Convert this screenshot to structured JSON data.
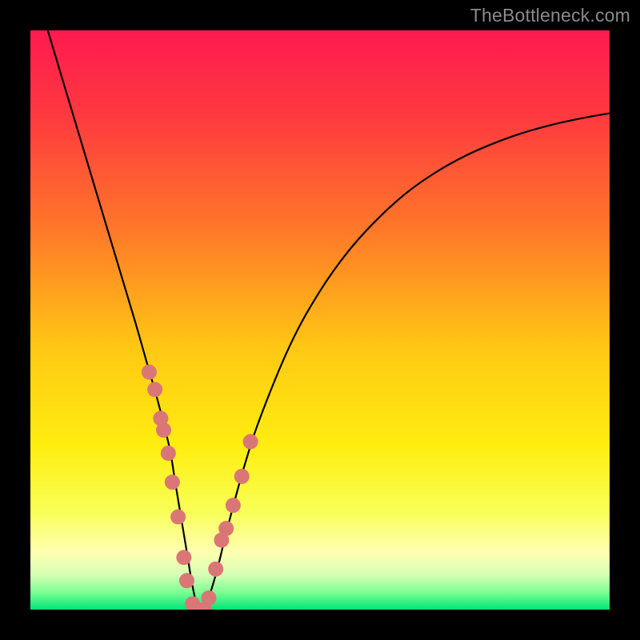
{
  "watermark": "TheBottleneck.com",
  "chart_data": {
    "type": "line",
    "title": "",
    "xlabel": "",
    "ylabel": "",
    "xlim": [
      0,
      100
    ],
    "ylim": [
      0,
      100
    ],
    "legend": false,
    "grid": false,
    "annotations": [],
    "background": {
      "type": "vertical-gradient",
      "stops": [
        {
          "pos": 0.0,
          "color": "#ff1a4f"
        },
        {
          "pos": 0.15,
          "color": "#ff3a3f"
        },
        {
          "pos": 0.35,
          "color": "#ff7a28"
        },
        {
          "pos": 0.55,
          "color": "#ffc813"
        },
        {
          "pos": 0.72,
          "color": "#ffee10"
        },
        {
          "pos": 0.83,
          "color": "#f8ff57"
        },
        {
          "pos": 0.9,
          "color": "#ffffb0"
        },
        {
          "pos": 0.94,
          "color": "#d6ffb5"
        },
        {
          "pos": 0.97,
          "color": "#7cff93"
        },
        {
          "pos": 1.0,
          "color": "#00e676"
        }
      ]
    },
    "series": [
      {
        "name": "curve",
        "color": "#000000",
        "x": [
          3,
          6,
          9,
          12,
          15,
          18,
          20,
          22,
          24,
          25,
          26,
          27,
          28,
          29,
          30,
          32,
          34,
          37,
          40,
          45,
          50,
          55,
          60,
          65,
          70,
          75,
          80,
          85,
          90,
          95,
          100
        ],
        "y": [
          100,
          90,
          80,
          70,
          60,
          50,
          43,
          36,
          28,
          22,
          16,
          10,
          4,
          0,
          0,
          6,
          14,
          25,
          34,
          46,
          55,
          62,
          67.5,
          72,
          75.5,
          78.3,
          80.5,
          82.3,
          83.7,
          84.8,
          85.7
        ]
      },
      {
        "name": "markers",
        "type": "scatter",
        "color": "#db7676",
        "x": [
          20.5,
          21.5,
          22.5,
          23.0,
          23.8,
          24.5,
          25.5,
          26.5,
          27.0,
          28.0,
          29.0,
          30.0,
          30.8,
          32.0,
          33.0,
          33.8,
          35.0,
          36.5,
          38.0
        ],
        "y": [
          41,
          38,
          33,
          31,
          27,
          22,
          16,
          9,
          5,
          1,
          0,
          0,
          2,
          7,
          12,
          14,
          18,
          23,
          29
        ]
      }
    ]
  }
}
